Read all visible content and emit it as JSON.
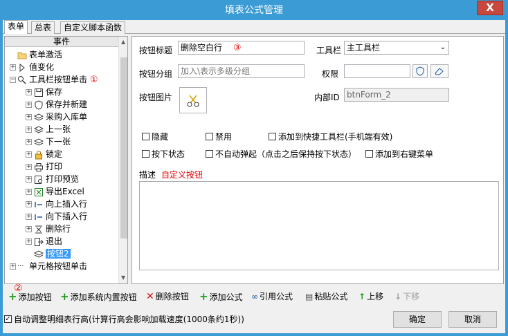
{
  "window": {
    "title": "填表公式管理",
    "close_label": "X"
  },
  "tabs": [
    {
      "label": "表单"
    },
    {
      "label": "总表"
    },
    {
      "label": "自定义脚本函数"
    }
  ],
  "tree": {
    "header": "事件",
    "nodes": [
      {
        "label": "表单激活",
        "icon": "folder-icon"
      },
      {
        "label": "值变化",
        "icon": "value-change-icon"
      },
      {
        "label": "工具栏按钮单击",
        "icon": "search-gear-icon",
        "marker": "①"
      },
      {
        "label": "保存",
        "icon": "save-icon"
      },
      {
        "label": "保存并新建",
        "icon": "shield-icon"
      },
      {
        "label": "采购入库单",
        "icon": "layers-icon"
      },
      {
        "label": "上一张",
        "icon": "layers-icon"
      },
      {
        "label": "下一张",
        "icon": "layers-icon"
      },
      {
        "label": "锁定",
        "icon": "lock-icon"
      },
      {
        "label": "打印",
        "icon": "printer-icon"
      },
      {
        "label": "打印预览",
        "icon": "print-preview-icon"
      },
      {
        "label": "导出Excel",
        "icon": "excel-icon"
      },
      {
        "label": "向上插入行",
        "icon": "insert-row-above-icon"
      },
      {
        "label": "向下插入行",
        "icon": "insert-row-below-icon"
      },
      {
        "label": "删除行",
        "icon": "delete-row-icon"
      },
      {
        "label": "退出",
        "icon": "exit-icon"
      },
      {
        "label": "按钮2",
        "icon": "layers-icon"
      },
      {
        "label": "单元格按钮单击",
        "icon": "dots-icon"
      }
    ]
  },
  "form": {
    "button_title_label": "按钮标题",
    "button_title_value": "删除空白行",
    "marker3": "③",
    "toolbar_label": "工具栏",
    "toolbar_value": "主工具栏",
    "group_label": "按钮分组",
    "group_placeholder": "加入\\表示多级分组",
    "permission_label": "权限",
    "permission_value": "",
    "image_label": "按钮图片",
    "internal_id_label": "内部ID",
    "internal_id_value": "btnForm_2",
    "checkboxes": [
      {
        "label": "隐藏"
      },
      {
        "label": "禁用"
      },
      {
        "label": "添加到快捷工具栏(手机端有效)"
      },
      {
        "label": "按下状态"
      },
      {
        "label": "不自动弹起（点击之后保持按下状态）"
      },
      {
        "label": "添加到右键菜单"
      }
    ],
    "desc_label": "描述",
    "desc_value": "自定义按钮",
    "desc_text": ""
  },
  "toolbar": {
    "marker2": "②",
    "add_button": "添加按钮",
    "add_builtin": "添加系统内置按钮",
    "delete_button": "删除按钮",
    "add_formula": "添加公式",
    "ref_formula": "引用公式",
    "paste_formula": "粘贴公式",
    "move_up": "上移",
    "move_down": "下移"
  },
  "footer": {
    "auto_height": "自动调整明细表行高(计算行高会影响加载速度(1000条约1秒))",
    "ok": "确定",
    "cancel": "取消"
  },
  "colors": {
    "titlebar": "#3b9bd4",
    "selection": "#3399ff",
    "accent_red": "#e00000",
    "add_green": "#1a9a1a",
    "delete_red": "#d01010"
  }
}
